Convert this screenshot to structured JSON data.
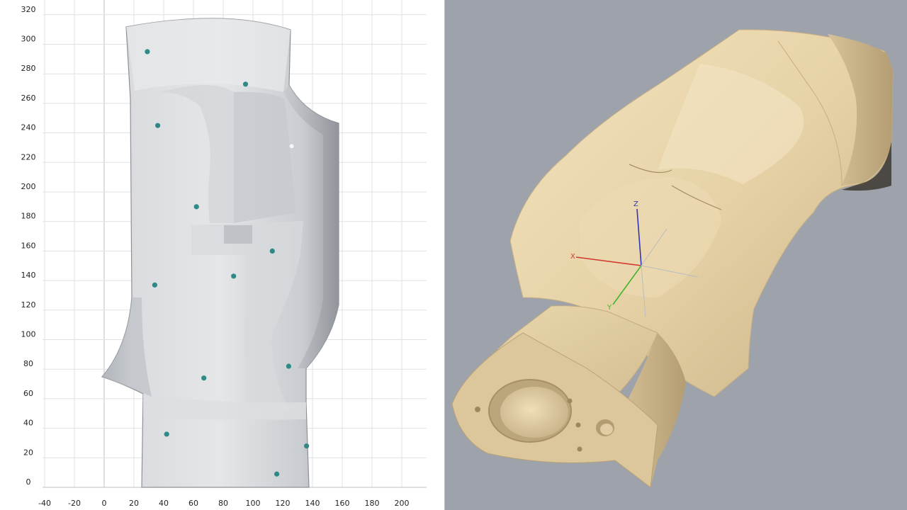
{
  "grid_view": {
    "x_ticks": [
      "-40",
      "-20",
      "0",
      "20",
      "40",
      "60",
      "80",
      "100",
      "120",
      "140",
      "160",
      "180",
      "200"
    ],
    "y_ticks": [
      "320",
      "300",
      "280",
      "260",
      "240",
      "220",
      "200",
      "180",
      "160",
      "140",
      "120",
      "100",
      "80",
      "60",
      "40",
      "20",
      "0"
    ],
    "x_range": [
      -40,
      210
    ],
    "y_range": [
      0,
      325
    ],
    "marker_color": "#2e8a86",
    "scan_color": "#cfd2d6"
  },
  "model_view": {
    "background_color": "#9ea2ab",
    "model_color": "#e3cfa3",
    "gizmo": {
      "x_label": "X",
      "y_label": "Y",
      "z_label": "Z",
      "x_color": "#d23a2e",
      "y_color": "#3fb52f",
      "z_color": "#2f35b8"
    }
  }
}
